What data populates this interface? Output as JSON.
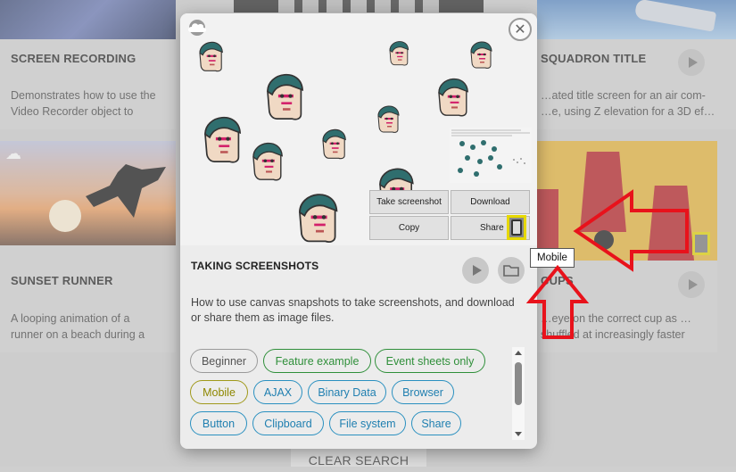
{
  "background_cards": {
    "screen_recording": {
      "title": "SCREEN RECORDING",
      "desc": "Demonstrates how to use the Video Recorder object to record a video"
    },
    "squadron_title": {
      "title": "SQUADRON TITLE",
      "desc": "…ated title screen for an air com- …e, using Z elevation for a 3D ef…"
    },
    "sunset_runner": {
      "title": "SUNSET RUNNER",
      "desc": "A looping animation of a runner on a beach during a beautiful sunset."
    },
    "cups": {
      "title": "CUPS",
      "desc": "…eye on the correct cup as …shuffled at increasingly faster"
    }
  },
  "modal": {
    "title": "TAKING SCREENSHOTS",
    "description": "How to use canvas snapshots to take screenshots, and download or share them as image files.",
    "buttons": {
      "take_screenshot": "Take screenshot",
      "download": "Download",
      "copy": "Copy",
      "share": "Share"
    },
    "tags": [
      {
        "label": "Beginner",
        "style": "gray"
      },
      {
        "label": "Feature example",
        "style": "green"
      },
      {
        "label": "Event sheets only",
        "style": "green"
      },
      {
        "label": "Mobile",
        "style": "olive"
      },
      {
        "label": "AJAX",
        "style": "blue"
      },
      {
        "label": "Binary Data",
        "style": "blue"
      },
      {
        "label": "Browser",
        "style": "blue"
      },
      {
        "label": "Button",
        "style": "blue"
      },
      {
        "label": "Clipboard",
        "style": "blue"
      },
      {
        "label": "File system",
        "style": "blue"
      },
      {
        "label": "Share",
        "style": "blue"
      }
    ],
    "close_symbol": "✕"
  },
  "tooltip": "Mobile",
  "footer": {
    "clear_search": "CLEAR SEARCH"
  },
  "colors": {
    "highlight_yellow": "#e6d800",
    "annotation_red": "#e8121b",
    "tag_green": "#2f8f3a",
    "tag_blue": "#2a90c0",
    "tag_olive": "#a0991a"
  }
}
